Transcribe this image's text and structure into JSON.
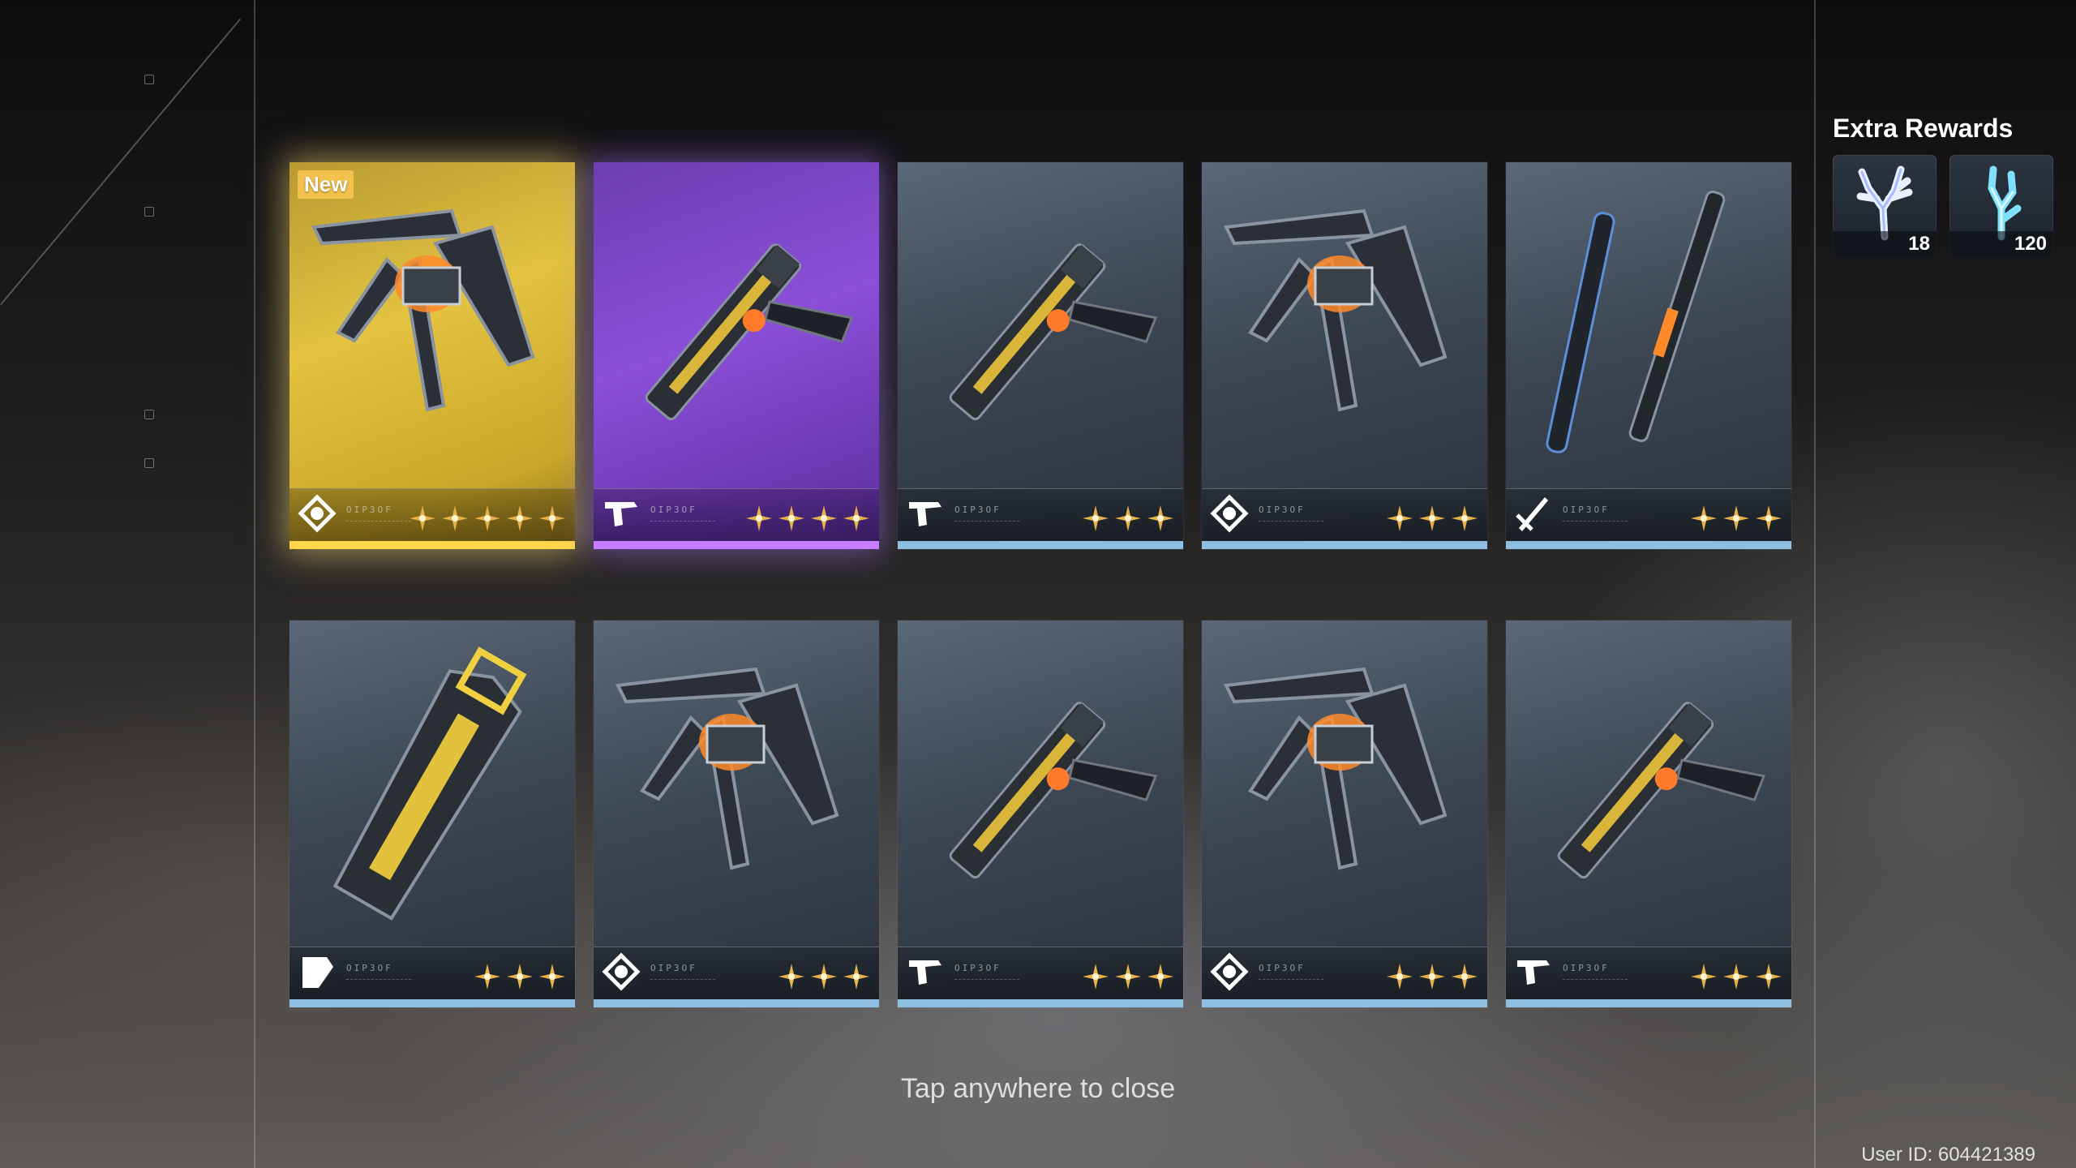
{
  "cards": [
    {
      "rarity": 5,
      "new_label": "New",
      "type": "rectifier",
      "item": "rectifier-art",
      "code": "OIP3OF"
    },
    {
      "rarity": 4,
      "new_label": "",
      "type": "pistol",
      "item": "pistol-art",
      "code": "OIP3OF"
    },
    {
      "rarity": 3,
      "new_label": "",
      "type": "pistol",
      "item": "pistol-art",
      "code": "OIP3OF"
    },
    {
      "rarity": 3,
      "new_label": "",
      "type": "rectifier",
      "item": "rectifier-art",
      "code": "OIP3OF"
    },
    {
      "rarity": 3,
      "new_label": "",
      "type": "sword",
      "item": "sword-art",
      "code": "OIP3OF"
    },
    {
      "rarity": 3,
      "new_label": "",
      "type": "broadblade",
      "item": "broadblade-art",
      "code": "OIP3OF"
    },
    {
      "rarity": 3,
      "new_label": "",
      "type": "rectifier",
      "item": "rectifier-art",
      "code": "OIP3OF"
    },
    {
      "rarity": 3,
      "new_label": "",
      "type": "pistol",
      "item": "pistol-art",
      "code": "OIP3OF"
    },
    {
      "rarity": 3,
      "new_label": "",
      "type": "rectifier",
      "item": "rectifier-art",
      "code": "OIP3OF"
    },
    {
      "rarity": 3,
      "new_label": "",
      "type": "pistol",
      "item": "pistol-art",
      "code": "OIP3OF"
    }
  ],
  "extra_rewards": {
    "title": "Extra Rewards",
    "items": [
      {
        "icon": "coral-icon",
        "quantity": "18",
        "color": "#e8f0ff"
      },
      {
        "icon": "coral-icon",
        "quantity": "120",
        "color": "#7fe0ff"
      }
    ]
  },
  "footer": {
    "tap_to_close": "Tap anywhere to close",
    "user_id": "User ID: 604421389"
  },
  "colors": {
    "gold": "#ffd84a",
    "purple": "#c77dff",
    "blue": "#8fbfe0",
    "star_gold": "#e6b24a"
  }
}
